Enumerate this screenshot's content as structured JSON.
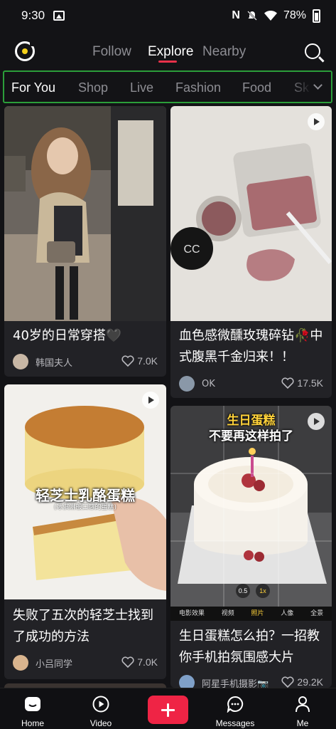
{
  "status_bar": {
    "time": "9:30",
    "battery": "78%"
  },
  "top_nav": {
    "tabs": [
      "Follow",
      "Explore",
      "Nearby"
    ],
    "active_tab": "Explore"
  },
  "categories": {
    "items": [
      "For You",
      "Shop",
      "Live",
      "Fashion",
      "Food",
      "Sk"
    ],
    "active": "For You"
  },
  "feed": {
    "left": [
      {
        "title": "40岁的日常穿搭🖤",
        "author": "韩国夫人",
        "likes": "7.0K"
      },
      {
        "title": "失败了五次的轻芝士找到了成功的方法",
        "author": "小吕同学",
        "likes": "7.0K",
        "overlay_text": "轻芝士乳酪蛋糕",
        "overlay_sub": "(冰淇淋般口感的蛋糕)"
      }
    ],
    "right": [
      {
        "title": "血色感微醺玫瑰碎钻🥀中式腹黑千金归来！！",
        "author": "OK",
        "likes": "17.5K"
      },
      {
        "title": "生日蛋糕怎么拍？一招教你手机拍氛围感大片",
        "author": "阿星手机摄影📷",
        "likes": "29.2K",
        "overlay_text_1": "生日蛋糕",
        "overlay_text_2": "不要再这样拍了",
        "camera_modes": [
          "电影效果",
          "视频",
          "照片",
          "人像",
          "全景"
        ],
        "camera_active": "照片",
        "zoom_1": "0.5",
        "zoom_2": "1x"
      }
    ]
  },
  "bottom_nav": {
    "items": [
      "Home",
      "Video",
      "Messages",
      "Me"
    ]
  },
  "colors": {
    "accent": "#ef2445",
    "background": "#131316",
    "card": "#222226",
    "highlight_border": "#2b9e3a"
  }
}
